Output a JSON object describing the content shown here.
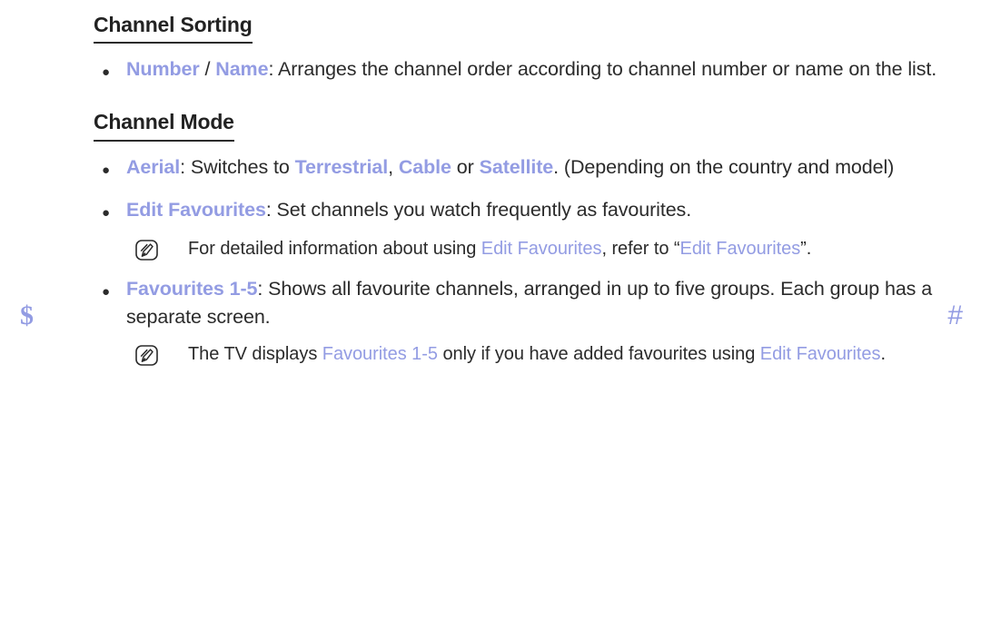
{
  "page": {
    "background": "#ffffff",
    "text_color": "#2b2b2b",
    "accent_color": "#939ce3"
  },
  "markers": {
    "left": "$",
    "right": "#"
  },
  "sections": [
    {
      "heading": "Channel Sorting",
      "bullets": [
        {
          "parts": [
            {
              "text": "Number",
              "style": "kw"
            },
            {
              "text": " / ",
              "style": "plain"
            },
            {
              "text": "Name",
              "style": "kw"
            },
            {
              "text": ": Arranges the channel order according to channel number or name on the list.",
              "style": "plain"
            }
          ],
          "notes": []
        }
      ]
    },
    {
      "heading": "Channel Mode",
      "bullets": [
        {
          "parts": [
            {
              "text": "Aerial",
              "style": "kw"
            },
            {
              "text": ": Switches to ",
              "style": "plain"
            },
            {
              "text": "Terrestrial",
              "style": "kw"
            },
            {
              "text": ", ",
              "style": "plain"
            },
            {
              "text": "Cable",
              "style": "kw"
            },
            {
              "text": " or ",
              "style": "plain"
            },
            {
              "text": "Satellite",
              "style": "kw"
            },
            {
              "text": ". (Depending on the country and model)",
              "style": "plain"
            }
          ],
          "notes": []
        },
        {
          "parts": [
            {
              "text": "Edit Favourites",
              "style": "kw"
            },
            {
              "text": ": Set channels you watch frequently as favourites.",
              "style": "plain"
            }
          ],
          "notes": [
            {
              "icon": "note-pencil-icon",
              "parts": [
                {
                  "text": "For detailed information about using ",
                  "style": "plain"
                },
                {
                  "text": "Edit Favourites",
                  "style": "kw-r"
                },
                {
                  "text": ", refer to “",
                  "style": "plain"
                },
                {
                  "text": "Edit Favourites",
                  "style": "kw-r"
                },
                {
                  "text": "”.",
                  "style": "plain"
                }
              ]
            }
          ]
        },
        {
          "parts": [
            {
              "text": "Favourites 1-5",
              "style": "kw"
            },
            {
              "text": ": Shows all favourite channels, arranged in up to five groups. Each group has a separate screen.",
              "style": "plain"
            }
          ],
          "notes": [
            {
              "icon": "note-pencil-icon",
              "parts": [
                {
                  "text": "The TV displays ",
                  "style": "plain"
                },
                {
                  "text": "Favourites 1-5",
                  "style": "kw-r"
                },
                {
                  "text": " only if you have added favourites using ",
                  "style": "plain"
                },
                {
                  "text": "Edit Favourites",
                  "style": "kw-r"
                },
                {
                  "text": ".",
                  "style": "plain"
                }
              ]
            }
          ]
        }
      ]
    }
  ]
}
